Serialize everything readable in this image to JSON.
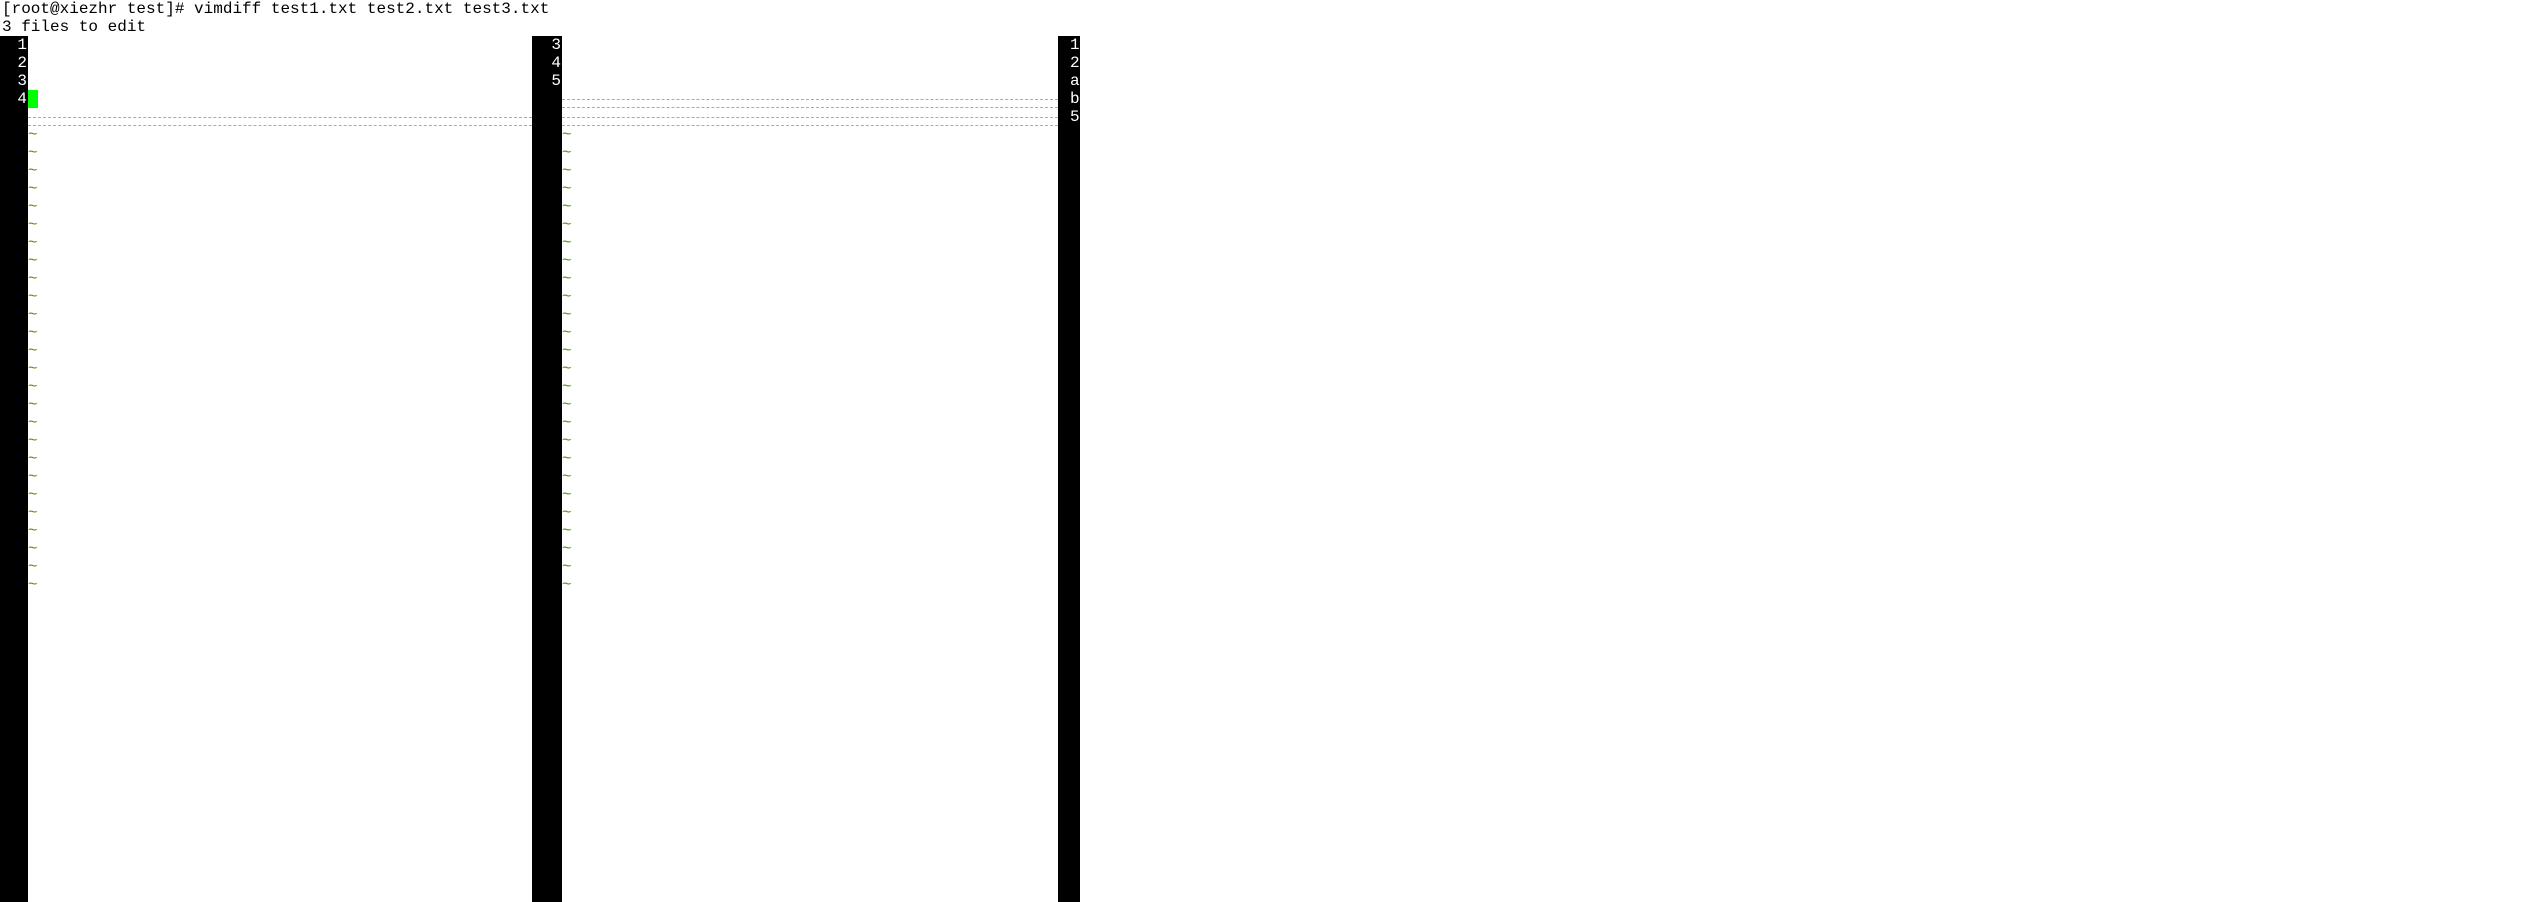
{
  "header": {
    "prompt": "[root@xiezhr test]# vimdiff test1.txt test2.txt test3.txt",
    "message": "3 files to edit"
  },
  "panes": {
    "p1": {
      "lines": [
        "1",
        "2",
        "3",
        "4"
      ],
      "cursor_line_index": 3,
      "filler_after": 1
    },
    "p2": {
      "lines": [
        "3",
        "4",
        "5"
      ],
      "filler_after": 2
    },
    "p3": {
      "lines": [
        "1",
        "2",
        "a",
        "b",
        "5"
      ],
      "filler_after": 0
    }
  },
  "tilde_glyph": "~",
  "tilde_rows": 26
}
